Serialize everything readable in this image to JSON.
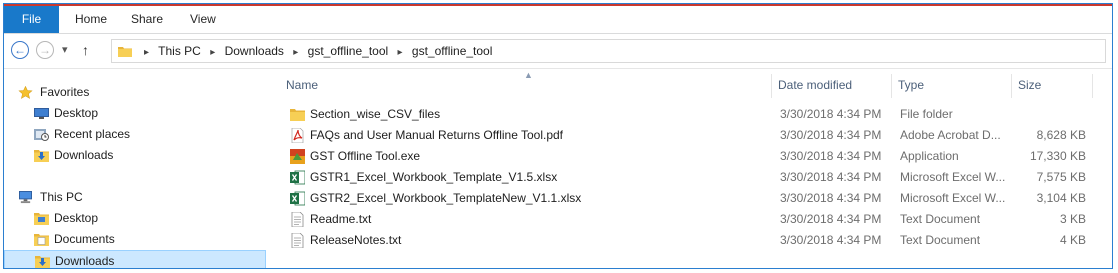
{
  "ribbon": {
    "tabs": [
      "File",
      "Home",
      "Share",
      "View"
    ]
  },
  "nav": {
    "breadcrumb": [
      "This PC",
      "Downloads",
      "gst_offline_tool",
      "gst_offline_tool"
    ]
  },
  "sidebar": {
    "favorites": {
      "label": "Favorites",
      "items": [
        {
          "label": "Desktop",
          "icon": "desktop-icon"
        },
        {
          "label": "Recent places",
          "icon": "recent-places-icon"
        },
        {
          "label": "Downloads",
          "icon": "downloads-icon"
        }
      ]
    },
    "thispc": {
      "label": "This PC",
      "items": [
        {
          "label": "Desktop",
          "icon": "desktop-folder-icon"
        },
        {
          "label": "Documents",
          "icon": "documents-icon"
        },
        {
          "label": "Downloads",
          "icon": "downloads-icon",
          "selected": true
        }
      ]
    }
  },
  "columns": {
    "name": "Name",
    "date": "Date modified",
    "type": "Type",
    "size": "Size"
  },
  "files": [
    {
      "name": "Section_wise_CSV_files",
      "date": "3/30/2018 4:34 PM",
      "type": "File folder",
      "size": "",
      "icon": "folder-icon"
    },
    {
      "name": "FAQs and User Manual  Returns Offline Tool.pdf",
      "date": "3/30/2018 4:34 PM",
      "type": "Adobe Acrobat D...",
      "size": "8,628 KB",
      "icon": "pdf-icon"
    },
    {
      "name": "GST Offline Tool.exe",
      "date": "3/30/2018 4:34 PM",
      "type": "Application",
      "size": "17,330 KB",
      "icon": "app-icon"
    },
    {
      "name": "GSTR1_Excel_Workbook_Template_V1.5.xlsx",
      "date": "3/30/2018 4:34 PM",
      "type": "Microsoft Excel W...",
      "size": "7,575 KB",
      "icon": "excel-icon"
    },
    {
      "name": "GSTR2_Excel_Workbook_TemplateNew_V1.1.xlsx",
      "date": "3/30/2018 4:34 PM",
      "type": "Microsoft Excel W...",
      "size": "3,104 KB",
      "icon": "excel-icon"
    },
    {
      "name": "Readme.txt",
      "date": "3/30/2018 4:34 PM",
      "type": "Text Document",
      "size": "3 KB",
      "icon": "text-file-icon"
    },
    {
      "name": "ReleaseNotes.txt",
      "date": "3/30/2018 4:34 PM",
      "type": "Text Document",
      "size": "4 KB",
      "icon": "text-file-icon"
    }
  ],
  "colors": {
    "file_tab": "#1979ca",
    "selection": "#cce8ff",
    "header_text": "#4c607a",
    "accent_strip": "#c9392f"
  }
}
